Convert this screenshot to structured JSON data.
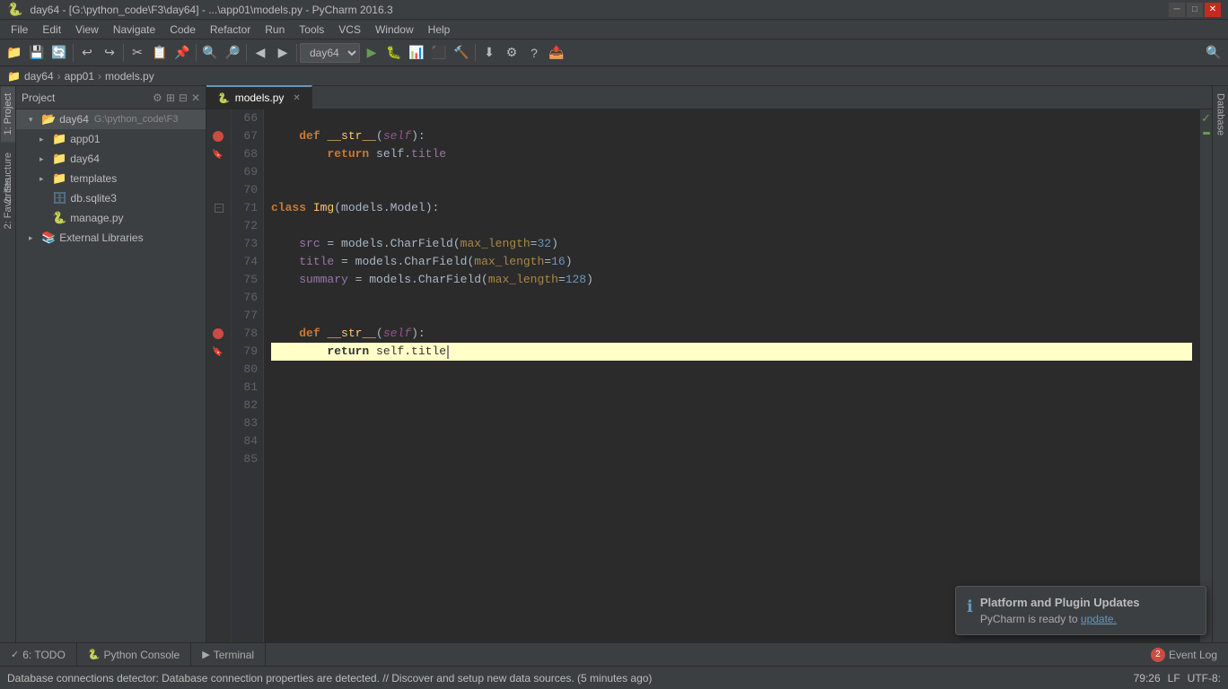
{
  "titlebar": {
    "text": "day64 - [G:\\python_code\\F3\\day64] - ...\\app01\\models.py - PyCharm 2016.3",
    "minimize": "─",
    "maximize": "□",
    "close": "✕"
  },
  "menubar": {
    "items": [
      "File",
      "Edit",
      "View",
      "Navigate",
      "Code",
      "Refactor",
      "Run",
      "Tools",
      "VCS",
      "Window",
      "Help"
    ]
  },
  "breadcrumb": {
    "items": [
      "day64",
      "app01",
      "models.py"
    ]
  },
  "sidebar": {
    "project_label": "Project",
    "tree": [
      {
        "id": "day64",
        "label": "day64",
        "type": "folder",
        "indent": 0,
        "expanded": true,
        "path": "G:\\python_code\\F3"
      },
      {
        "id": "app01",
        "label": "app01",
        "type": "folder",
        "indent": 1,
        "expanded": false
      },
      {
        "id": "day64sub",
        "label": "day64",
        "type": "folder",
        "indent": 1,
        "expanded": false
      },
      {
        "id": "templates",
        "label": "templates",
        "type": "folder",
        "indent": 1,
        "expanded": false
      },
      {
        "id": "db.sqlite3",
        "label": "db.sqlite3",
        "type": "file-db",
        "indent": 1
      },
      {
        "id": "manage.py",
        "label": "manage.py",
        "type": "file-py",
        "indent": 1
      },
      {
        "id": "extlibs",
        "label": "External Libraries",
        "type": "folder-ext",
        "indent": 0,
        "expanded": false
      }
    ]
  },
  "editor": {
    "tab_label": "models.py",
    "lines": [
      {
        "num": 66,
        "content": "",
        "type": "blank"
      },
      {
        "num": 67,
        "content": "    def __str__(self):",
        "type": "code",
        "breakpoint": true,
        "fold": false
      },
      {
        "num": 68,
        "content": "        return self.title",
        "type": "code",
        "bookmark": true
      },
      {
        "num": 69,
        "content": "",
        "type": "blank"
      },
      {
        "num": 70,
        "content": "",
        "type": "blank"
      },
      {
        "num": 71,
        "content": "class Img(models.Model):",
        "type": "code",
        "fold": true
      },
      {
        "num": 72,
        "content": "",
        "type": "blank"
      },
      {
        "num": 73,
        "content": "    src = models.CharField(max_length=32)",
        "type": "code"
      },
      {
        "num": 74,
        "content": "    title = models.CharField(max_length=16)",
        "type": "code"
      },
      {
        "num": 75,
        "content": "    summary = models.CharField(max_length=128)",
        "type": "code"
      },
      {
        "num": 76,
        "content": "",
        "type": "blank"
      },
      {
        "num": 77,
        "content": "",
        "type": "blank"
      },
      {
        "num": 78,
        "content": "    def __str__(self):",
        "type": "code",
        "breakpoint": true,
        "fold": false
      },
      {
        "num": 79,
        "content": "        return self.title",
        "type": "code",
        "active": true,
        "cursor": true
      },
      {
        "num": 80,
        "content": "",
        "type": "blank"
      },
      {
        "num": 81,
        "content": "",
        "type": "blank"
      },
      {
        "num": 82,
        "content": "",
        "type": "blank"
      },
      {
        "num": 83,
        "content": "",
        "type": "blank"
      },
      {
        "num": 84,
        "content": "",
        "type": "blank"
      },
      {
        "num": 85,
        "content": "",
        "type": "blank"
      }
    ]
  },
  "notification": {
    "title": "Platform and Plugin Updates",
    "text": "PyCharm is ready to ",
    "link_text": "update.",
    "icon": "ℹ"
  },
  "bottom_tabs": [
    {
      "label": "6: TODO",
      "icon": "✓",
      "active": false
    },
    {
      "label": "Python Console",
      "icon": "🐍",
      "active": false
    },
    {
      "label": "Terminal",
      "icon": "▶",
      "active": false
    }
  ],
  "status_bar": {
    "message": "Database connections detector: Database connection properties are detected. // Discover and setup new data sources. (5 minutes ago)",
    "position": "79:26",
    "line_sep": "LF",
    "encoding": "UTF-8",
    "event_log": "Event Log",
    "event_count": "2"
  },
  "left_panel_tabs": [
    {
      "label": "1: Project",
      "active": true
    },
    {
      "label": "2: Structure",
      "active": false
    },
    {
      "label": "2: Favorites",
      "active": false
    }
  ],
  "right_panel_tabs": [
    {
      "label": "Database",
      "active": false
    }
  ]
}
